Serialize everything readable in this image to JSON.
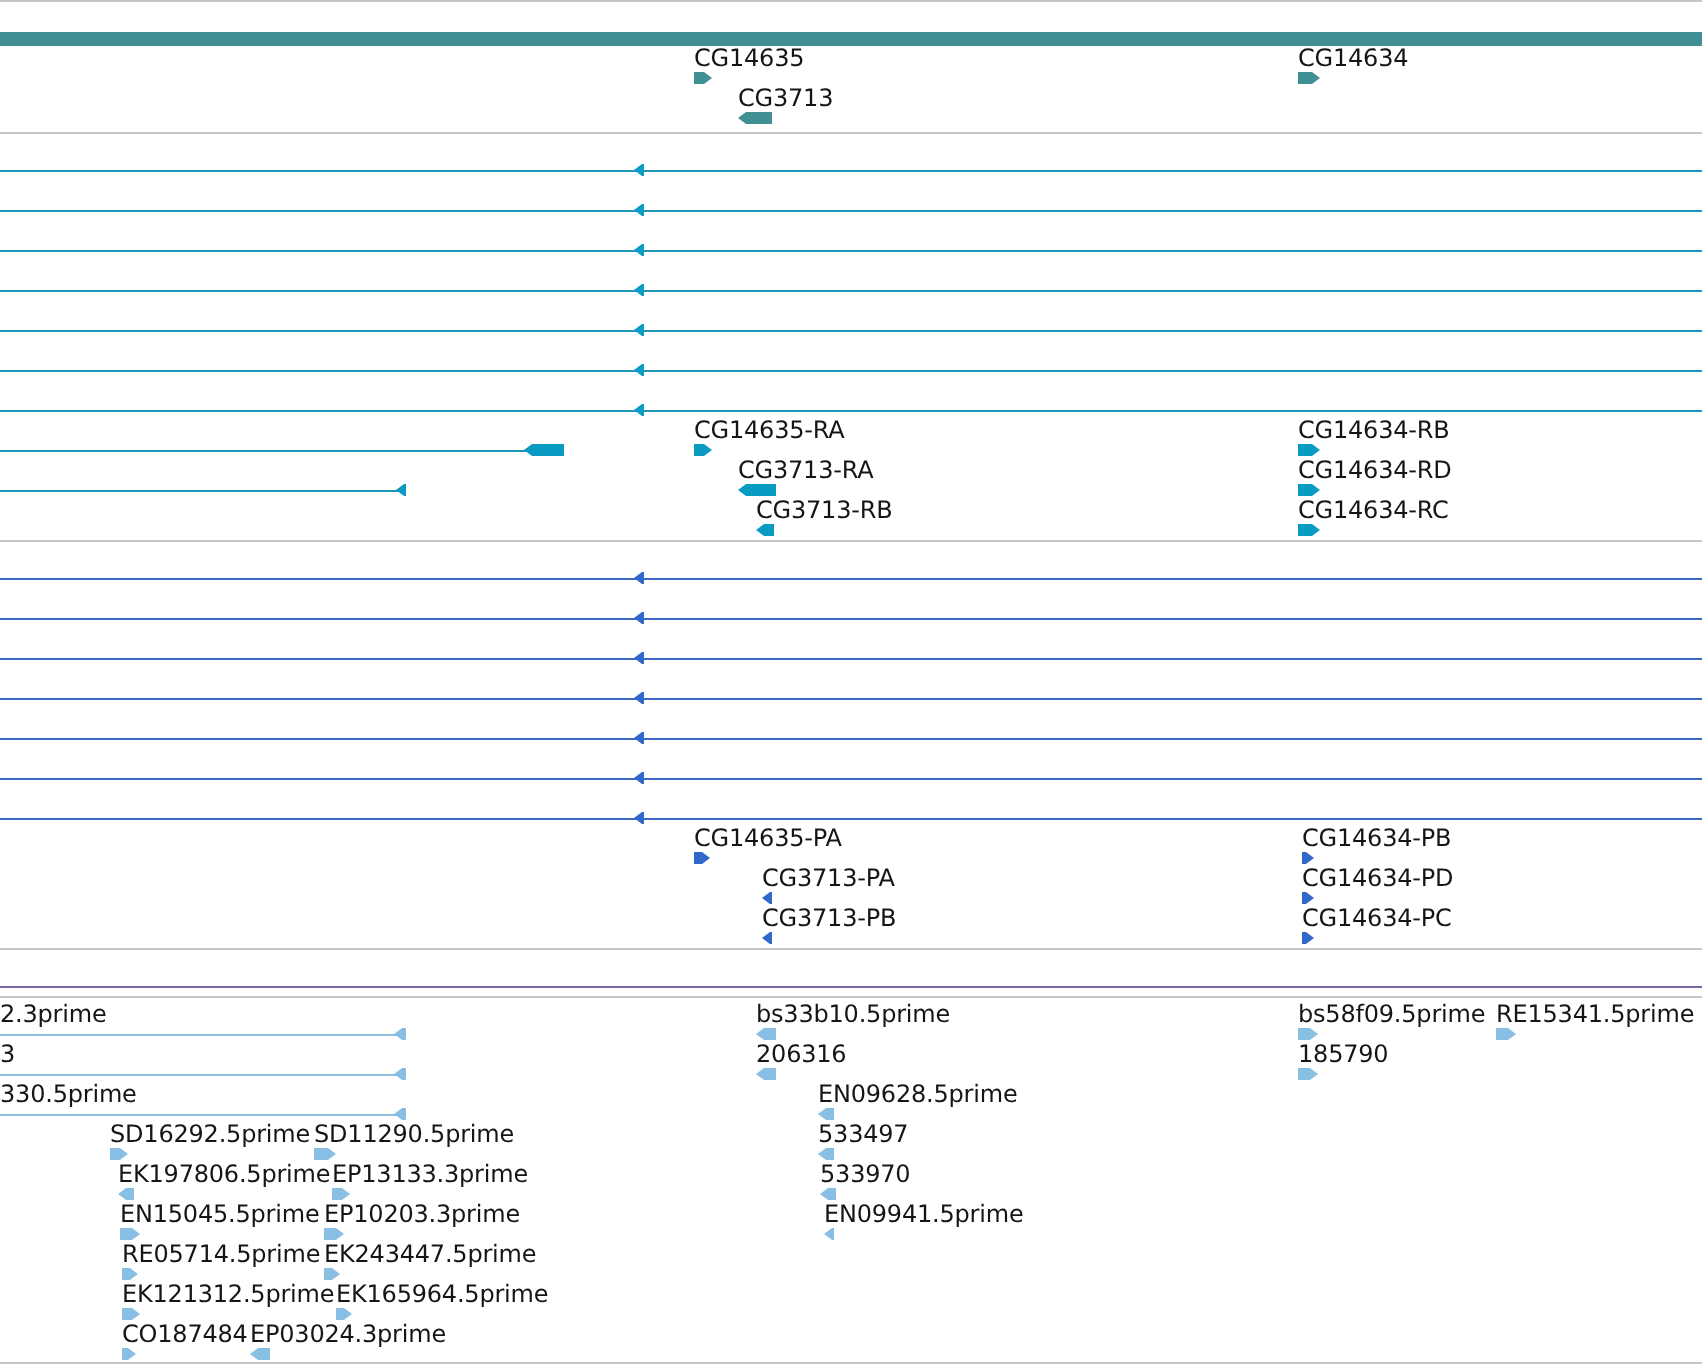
{
  "tracks": [
    {
      "kind": "genes",
      "features": [
        {
          "kind": "bar"
        },
        {
          "kind": "block",
          "label": "CG14635",
          "reverse": false
        },
        {
          "kind": "block",
          "label": "CG14634",
          "reverse": false
        },
        {
          "kind": "block",
          "label": "CG3713",
          "reverse": true
        }
      ]
    },
    {
      "kind": "transcripts",
      "features": [
        {
          "kind": "line",
          "reverse": true
        },
        {
          "kind": "line",
          "reverse": true
        },
        {
          "kind": "line",
          "reverse": true
        },
        {
          "kind": "line",
          "reverse": true
        },
        {
          "kind": "line",
          "reverse": true
        },
        {
          "kind": "line",
          "reverse": true
        },
        {
          "kind": "line",
          "reverse": true
        },
        {
          "kind": "line",
          "reverse": true
        },
        {
          "kind": "block",
          "label": "CG14635-RA",
          "reverse": false
        },
        {
          "kind": "block",
          "label": "CG14634-RB",
          "reverse": false
        },
        {
          "kind": "line",
          "reverse": true
        },
        {
          "kind": "block",
          "label": "CG3713-RA",
          "reverse": true
        },
        {
          "kind": "block",
          "label": "CG14634-RD",
          "reverse": false
        },
        {
          "kind": "block",
          "label": "CG3713-RB",
          "reverse": true
        },
        {
          "kind": "block",
          "label": "CG14634-RC",
          "reverse": false
        }
      ]
    },
    {
      "kind": "proteins",
      "features": [
        {
          "kind": "line",
          "reverse": true
        },
        {
          "kind": "line",
          "reverse": true
        },
        {
          "kind": "line",
          "reverse": true
        },
        {
          "kind": "line",
          "reverse": true
        },
        {
          "kind": "line",
          "reverse": true
        },
        {
          "kind": "line",
          "reverse": true
        },
        {
          "kind": "line",
          "reverse": true
        },
        {
          "kind": "block",
          "label": "CG14635-PA",
          "reverse": false
        },
        {
          "kind": "block",
          "label": "CG14634-PB",
          "reverse": false
        },
        {
          "kind": "block",
          "label": "CG3713-PA",
          "reverse": true
        },
        {
          "kind": "block",
          "label": "CG14634-PD",
          "reverse": false
        },
        {
          "kind": "block",
          "label": "CG3713-PB",
          "reverse": true
        },
        {
          "kind": "block",
          "label": "CG14634-PC",
          "reverse": false
        }
      ]
    },
    {
      "kind": "ests",
      "features": [
        {
          "kind": "line",
          "label": "2.3prime",
          "reverse": true
        },
        {
          "kind": "block",
          "label": "bs33b10.5prime",
          "reverse": true
        },
        {
          "kind": "block",
          "label": "bs58f09.5prime",
          "reverse": false
        },
        {
          "kind": "block",
          "label": "RE15341.5prime",
          "reverse": false
        },
        {
          "kind": "line",
          "label": "3",
          "reverse": true
        },
        {
          "kind": "block",
          "label": "206316",
          "reverse": true
        },
        {
          "kind": "block",
          "label": "185790",
          "reverse": false
        },
        {
          "kind": "line",
          "label": "330.5prime",
          "reverse": true
        },
        {
          "kind": "block",
          "label": "EN09628.5prime",
          "reverse": true
        },
        {
          "kind": "block",
          "label": "SD16292.5prime",
          "reverse": false
        },
        {
          "kind": "block",
          "label": "SD11290.5prime",
          "reverse": false
        },
        {
          "kind": "block",
          "label": "533497",
          "reverse": true
        },
        {
          "kind": "block",
          "label": "EK197806.5prime",
          "reverse": true
        },
        {
          "kind": "block",
          "label": "EP13133.3prime",
          "reverse": false
        },
        {
          "kind": "block",
          "label": "533970",
          "reverse": true
        },
        {
          "kind": "block",
          "label": "EN15045.5prime",
          "reverse": false
        },
        {
          "kind": "block",
          "label": "EP10203.3prime",
          "reverse": false
        },
        {
          "kind": "block",
          "label": "EN09941.5prime",
          "reverse": true
        },
        {
          "kind": "block",
          "label": "RE05714.5prime",
          "reverse": false
        },
        {
          "kind": "block",
          "label": "EK243447.5prime",
          "reverse": false
        },
        {
          "kind": "block",
          "label": "EK121312.5prime",
          "reverse": false
        },
        {
          "kind": "block",
          "label": "EK165964.5prime",
          "reverse": false
        },
        {
          "kind": "block",
          "label": "CO187484",
          "reverse": false
        },
        {
          "kind": "block",
          "label": "EP03024.3prime",
          "reverse": true
        }
      ]
    }
  ]
}
